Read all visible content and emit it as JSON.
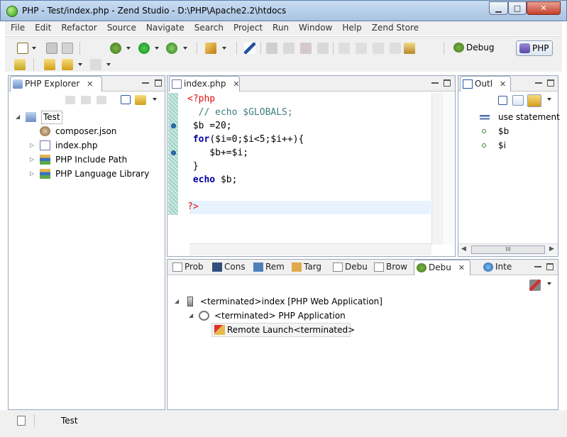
{
  "window": {
    "title": "PHP - Test/index.php - Zend Studio - D:\\PHP\\Apache2.2\\htdocs",
    "min_label": "▁",
    "max_label": "□",
    "close_label": "✕"
  },
  "menu": [
    "File",
    "Edit",
    "Refactor",
    "Source",
    "Navigate",
    "Search",
    "Project",
    "Run",
    "Window",
    "Help",
    "Zend Store"
  ],
  "perspectives": {
    "debug": "Debug",
    "php": "PHP"
  },
  "explorer": {
    "tab": "PHP Explorer",
    "close": "✕",
    "root": "Test",
    "items": [
      "composer.json",
      "index.php",
      "PHP Include Path",
      "PHP Language Library"
    ]
  },
  "editor": {
    "tab": "index.php",
    "close": "✕",
    "lines": {
      "l1": "<?php",
      "l2": "  // echo $GLOBALS;",
      "l3_var": " $b =20;",
      "l4_kw": " for",
      "l4_rest": "($i=0;$i<5;$i++){",
      "l5": "    $b+=$i;",
      "l6": " }",
      "l7_kw": " echo",
      "l7_rest": " $b;",
      "l9": "?>"
    }
  },
  "outline": {
    "tab": "Outl",
    "close": "✕",
    "items": [
      "use statement",
      "$b",
      "$i"
    ],
    "hscroll": "III"
  },
  "bottom": {
    "tabs": [
      "Prob",
      "Cons",
      "Rem",
      "Targ",
      "Debu",
      "Brow",
      "Debu",
      "Inte"
    ],
    "close": "✕",
    "tree": [
      "<terminated>index [PHP Web Application]",
      "<terminated> PHP Application",
      "Remote Launch<terminated>"
    ]
  },
  "status": {
    "text": "Test"
  },
  "colors": {
    "accent": "#3c6eb4",
    "php_tag": "#e01010",
    "keyword": "#0000a0",
    "comment": "#3f7f7f"
  }
}
